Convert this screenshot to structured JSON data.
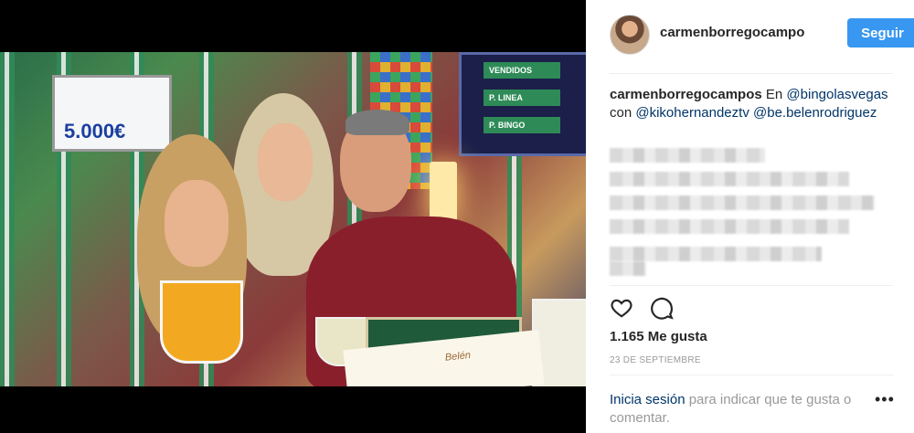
{
  "post": {
    "username": "carmenborregocampos",
    "follow_label": "Seguir",
    "caption": {
      "user": "carmenborregocampos",
      "text_before": " En ",
      "mention1": "@bingolasvegas",
      "text_middle": " con ",
      "mention2": "@kikohernandeztv",
      "text_end": " ",
      "mention3": "@be.belenrodriguez"
    },
    "likes": "1.165 Me gusta",
    "date": "23 de septiembre",
    "login_link": "Inicia sesión",
    "login_rest": " para indicar que te gusta o comentar.",
    "more_symbol": "•••"
  },
  "photo": {
    "screen_amount": "5.000€",
    "board_rows": [
      "VENDIDOS",
      "P. LINEA",
      "P. BINGO"
    ],
    "card_text": "Belén"
  },
  "icons": {
    "like": "heart-icon",
    "comment": "comment-icon",
    "more": "more-icon"
  },
  "colors": {
    "follow_button": "#3897f0",
    "mention": "#003569",
    "muted": "#999999",
    "text": "#262626"
  }
}
